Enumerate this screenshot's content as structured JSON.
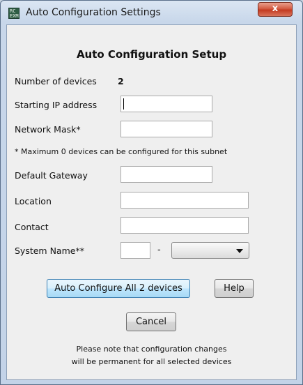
{
  "window": {
    "title": "Auto Configuration Settings",
    "app_icon_text": "RC\nEXM",
    "close_glyph": "x"
  },
  "form": {
    "heading": "Auto Configuration Setup",
    "num_devices_label": "Number of devices",
    "num_devices_value": "2",
    "starting_ip_label": "Starting IP address",
    "starting_ip_value": "",
    "network_mask_label": "Network Mask*",
    "network_mask_value": "",
    "subnet_note": "* Maximum 0 devices can be configured for this subnet",
    "gateway_label": "Default Gateway",
    "gateway_value": "",
    "location_label": "Location",
    "location_value": "",
    "contact_label": "Contact",
    "contact_value": "",
    "system_name_label": "System Name**",
    "system_name_value": "",
    "system_name_separator": "-",
    "system_name_suffix_selected": ""
  },
  "buttons": {
    "auto_configure": "Auto Configure All 2 devices",
    "help": "Help",
    "cancel": "Cancel"
  },
  "footer": {
    "line1": "Please note that configuration changes",
    "line2": "will be permanent for all selected devices"
  }
}
